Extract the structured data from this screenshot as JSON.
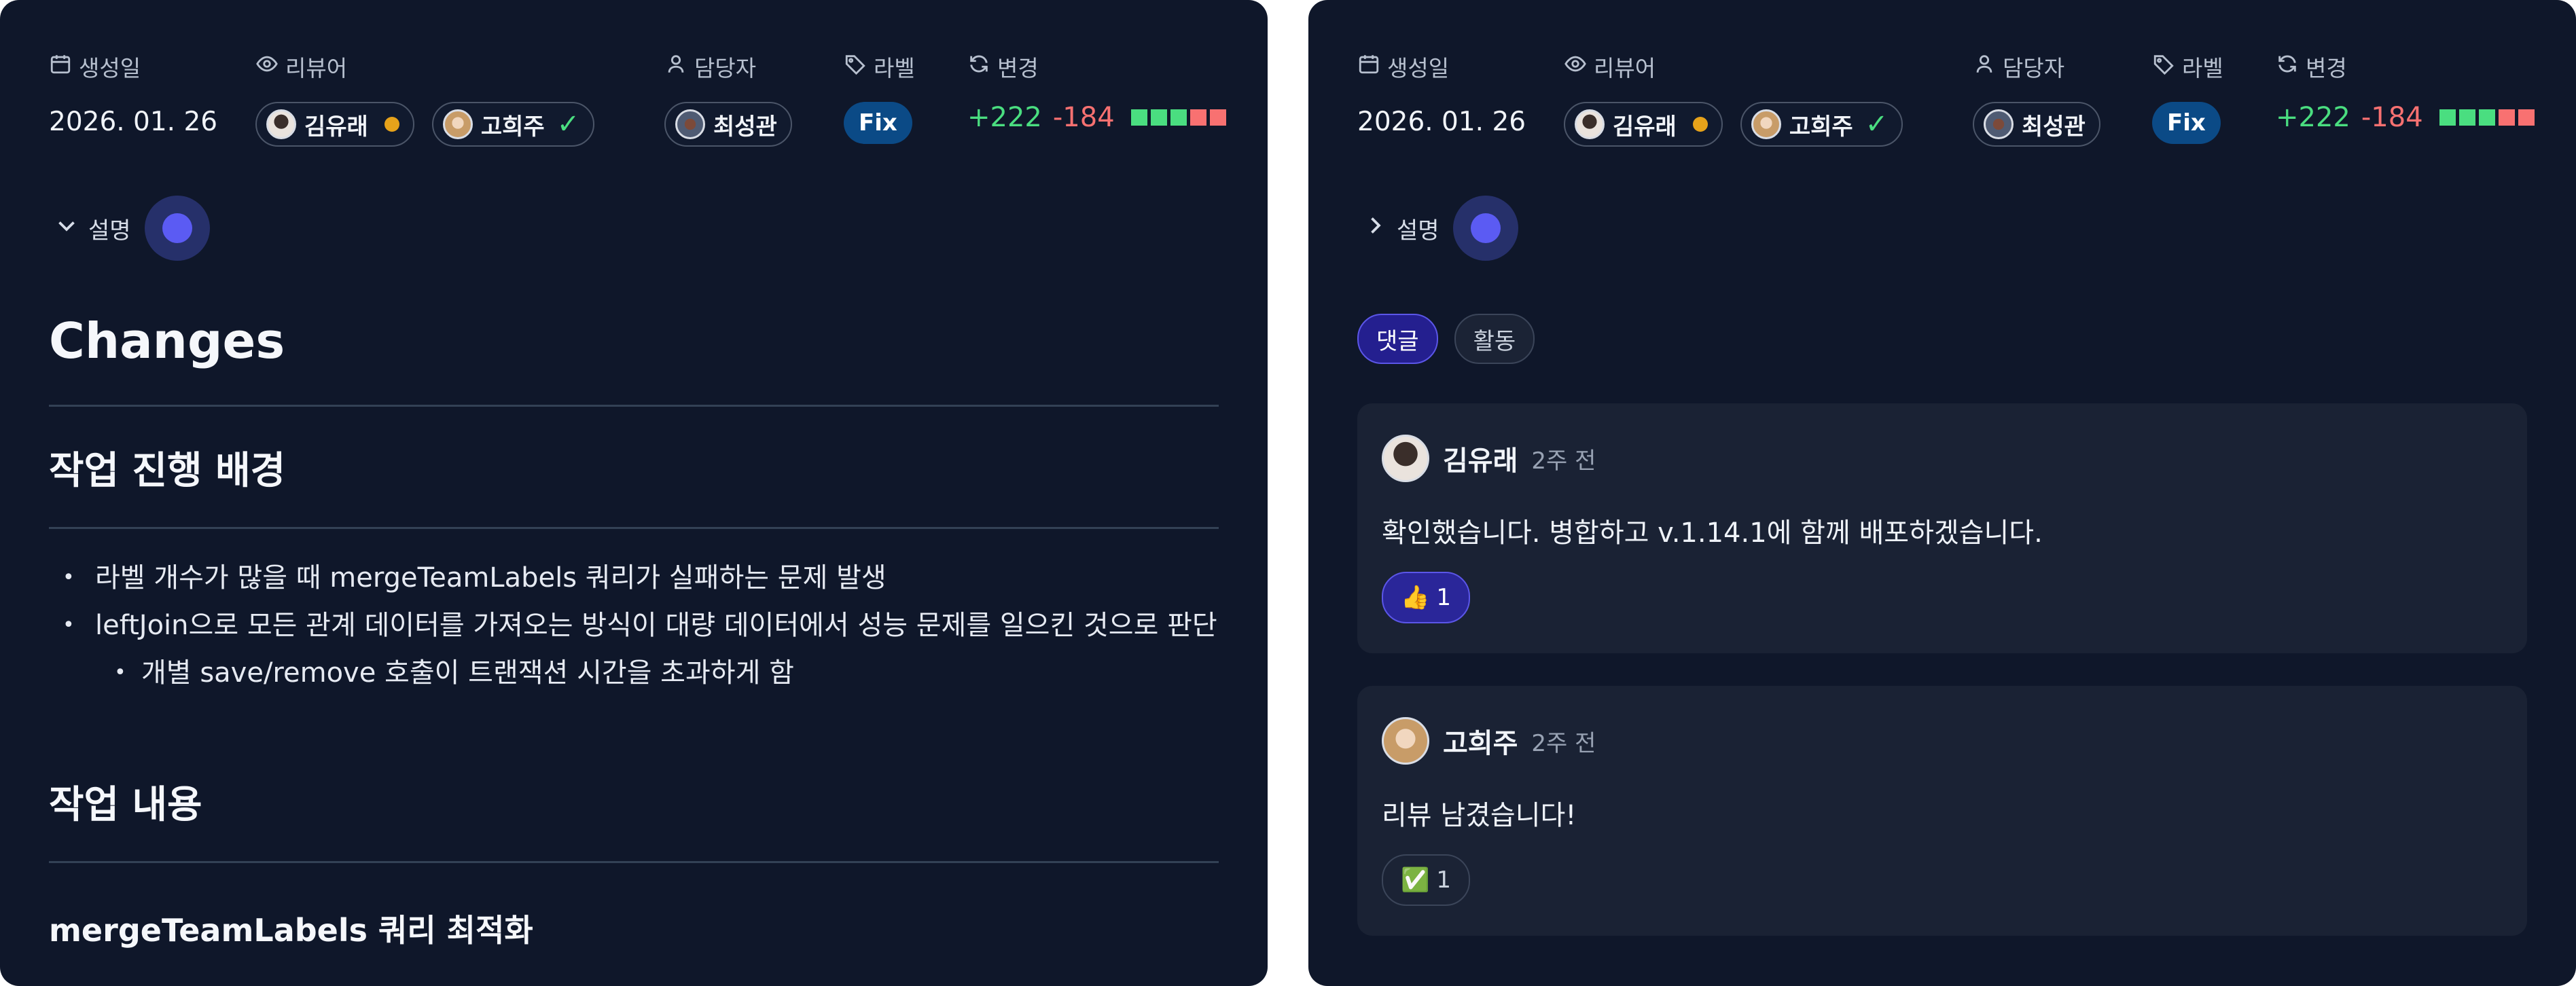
{
  "meta": {
    "created_label": "생성일",
    "created_value": "2026. 01. 26",
    "reviewers_label": "리뷰어",
    "assignee_label": "담당자",
    "label_label": "라벨",
    "changes_label": "변경",
    "reviewers": [
      {
        "name": "김유래",
        "status": "pending",
        "status_color": "#e6a21a"
      },
      {
        "name": "고희주",
        "status": "approved",
        "status_color": "#4ade80"
      }
    ],
    "assignee": "최성관",
    "label": "Fix",
    "label_color": "#0b4a86",
    "additions": "+222",
    "deletions": "-184",
    "diff_blocks": [
      "#4ade80",
      "#4ade80",
      "#4ade80",
      "#f87171",
      "#f87171"
    ]
  },
  "description_toggle": "설명",
  "markdown": {
    "h1": "Changes",
    "section1_title": "작업 진행 배경",
    "bullets": [
      "라벨 개수가 많을 때 mergeTeamLabels 쿼리가 실패하는 문제 발생",
      "leftJoin으로 모든 관계 데이터를 가져오는 방식이 대량 데이터에서 성능 문제를 일으킨 것으로 판단"
    ],
    "sub_bullet": "개별 save/remove 호출이 트랜잭션 시간을 초과하게 함",
    "section2_title": "작업 내용",
    "subsection_title": "mergeTeamLabels 쿼리 최적화"
  },
  "tabs": [
    {
      "label": "댓글",
      "active": true
    },
    {
      "label": "활동",
      "active": false
    }
  ],
  "comments": [
    {
      "author": "김유래",
      "time": "2주 전",
      "text": "확인했습니다. 병합하고 v.1.14.1에 함께 배포하겠습니다.",
      "reaction_emoji": "👍",
      "reaction_count": "1"
    },
    {
      "author": "고희주",
      "time": "2주 전",
      "text": "리뷰 남겼습니다!",
      "reaction_emoji": "✅",
      "reaction_count": "1"
    }
  ]
}
